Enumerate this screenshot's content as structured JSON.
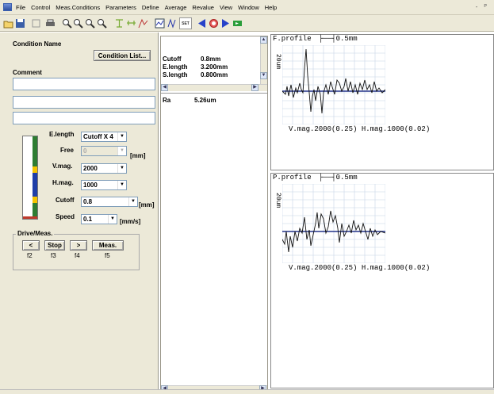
{
  "menu": {
    "items": [
      "File",
      "Control",
      "Meas.Conditions",
      "Parameters",
      "Define",
      "Average",
      "Revalue",
      "View",
      "Window",
      "Help"
    ],
    "window_controls": "- ᴾ"
  },
  "toolbar": {
    "icons": [
      "open-icon",
      "save-icon",
      "undo-icon",
      "print-icon",
      "zoom-icon",
      "zoom-in-icon",
      "zoom-out-icon",
      "fit-icon",
      "filter-icon",
      "scale-icon",
      "compare-icon",
      "graph-icon",
      "set-icon",
      "left-arrow-icon",
      "stop-icon",
      "right-arrow-icon",
      "start-icon"
    ],
    "set_label": "SET"
  },
  "left": {
    "condition_name_label": "Condition Name",
    "condition_list_button": "Condition List...",
    "comment_label": "Comment",
    "fields": [
      "",
      "",
      ""
    ],
    "params": {
      "elength_label": "E.length",
      "elength_value": "Cutoff X 4",
      "free_label": "Free",
      "free_value": "0",
      "free_unit": "[mm]",
      "vmag_label": "V.mag.",
      "vmag_value": "2000",
      "hmag_label": "H.mag.",
      "hmag_value": "1000",
      "cutoff_label": "Cutoff",
      "cutoff_value": "0.8",
      "cutoff_unit": "[mm]",
      "speed_label": "Speed",
      "speed_value": "0.1",
      "speed_unit": "[mm/s]"
    },
    "drive": {
      "group_label": "Drive/Meas.",
      "buttons": [
        {
          "label": "<",
          "key": "f2"
        },
        {
          "label": "Stop",
          "key": "f3"
        },
        {
          "label": ">",
          "key": "f4"
        },
        {
          "label": "Meas.",
          "key": "f5"
        }
      ]
    },
    "colors": {
      "bar_top": "#2e7d32",
      "bar_mid": "#f5c400",
      "bar_blue": "#1e3ea8",
      "bar_bottom": "#c0392b"
    }
  },
  "middle": {
    "conditions": [
      {
        "name": "Cutoff",
        "value": "0.8mm"
      },
      {
        "name": "E.length",
        "value": "3.200mm"
      },
      {
        "name": "S.length",
        "value": "0.800mm"
      }
    ],
    "results": [
      {
        "name": "Ra",
        "value": "5.26um"
      }
    ]
  },
  "graphs": [
    {
      "title": "F.profile",
      "h_scale": "0.5mm",
      "v_scale": "20um",
      "mag": "V.mag.2000(0.25) H.mag.1000(0.02)"
    },
    {
      "title": "P.profile",
      "h_scale": "0.5mm",
      "v_scale": "20um",
      "mag": "V.mag.2000(0.25) H.mag.1000(0.02)"
    }
  ]
}
